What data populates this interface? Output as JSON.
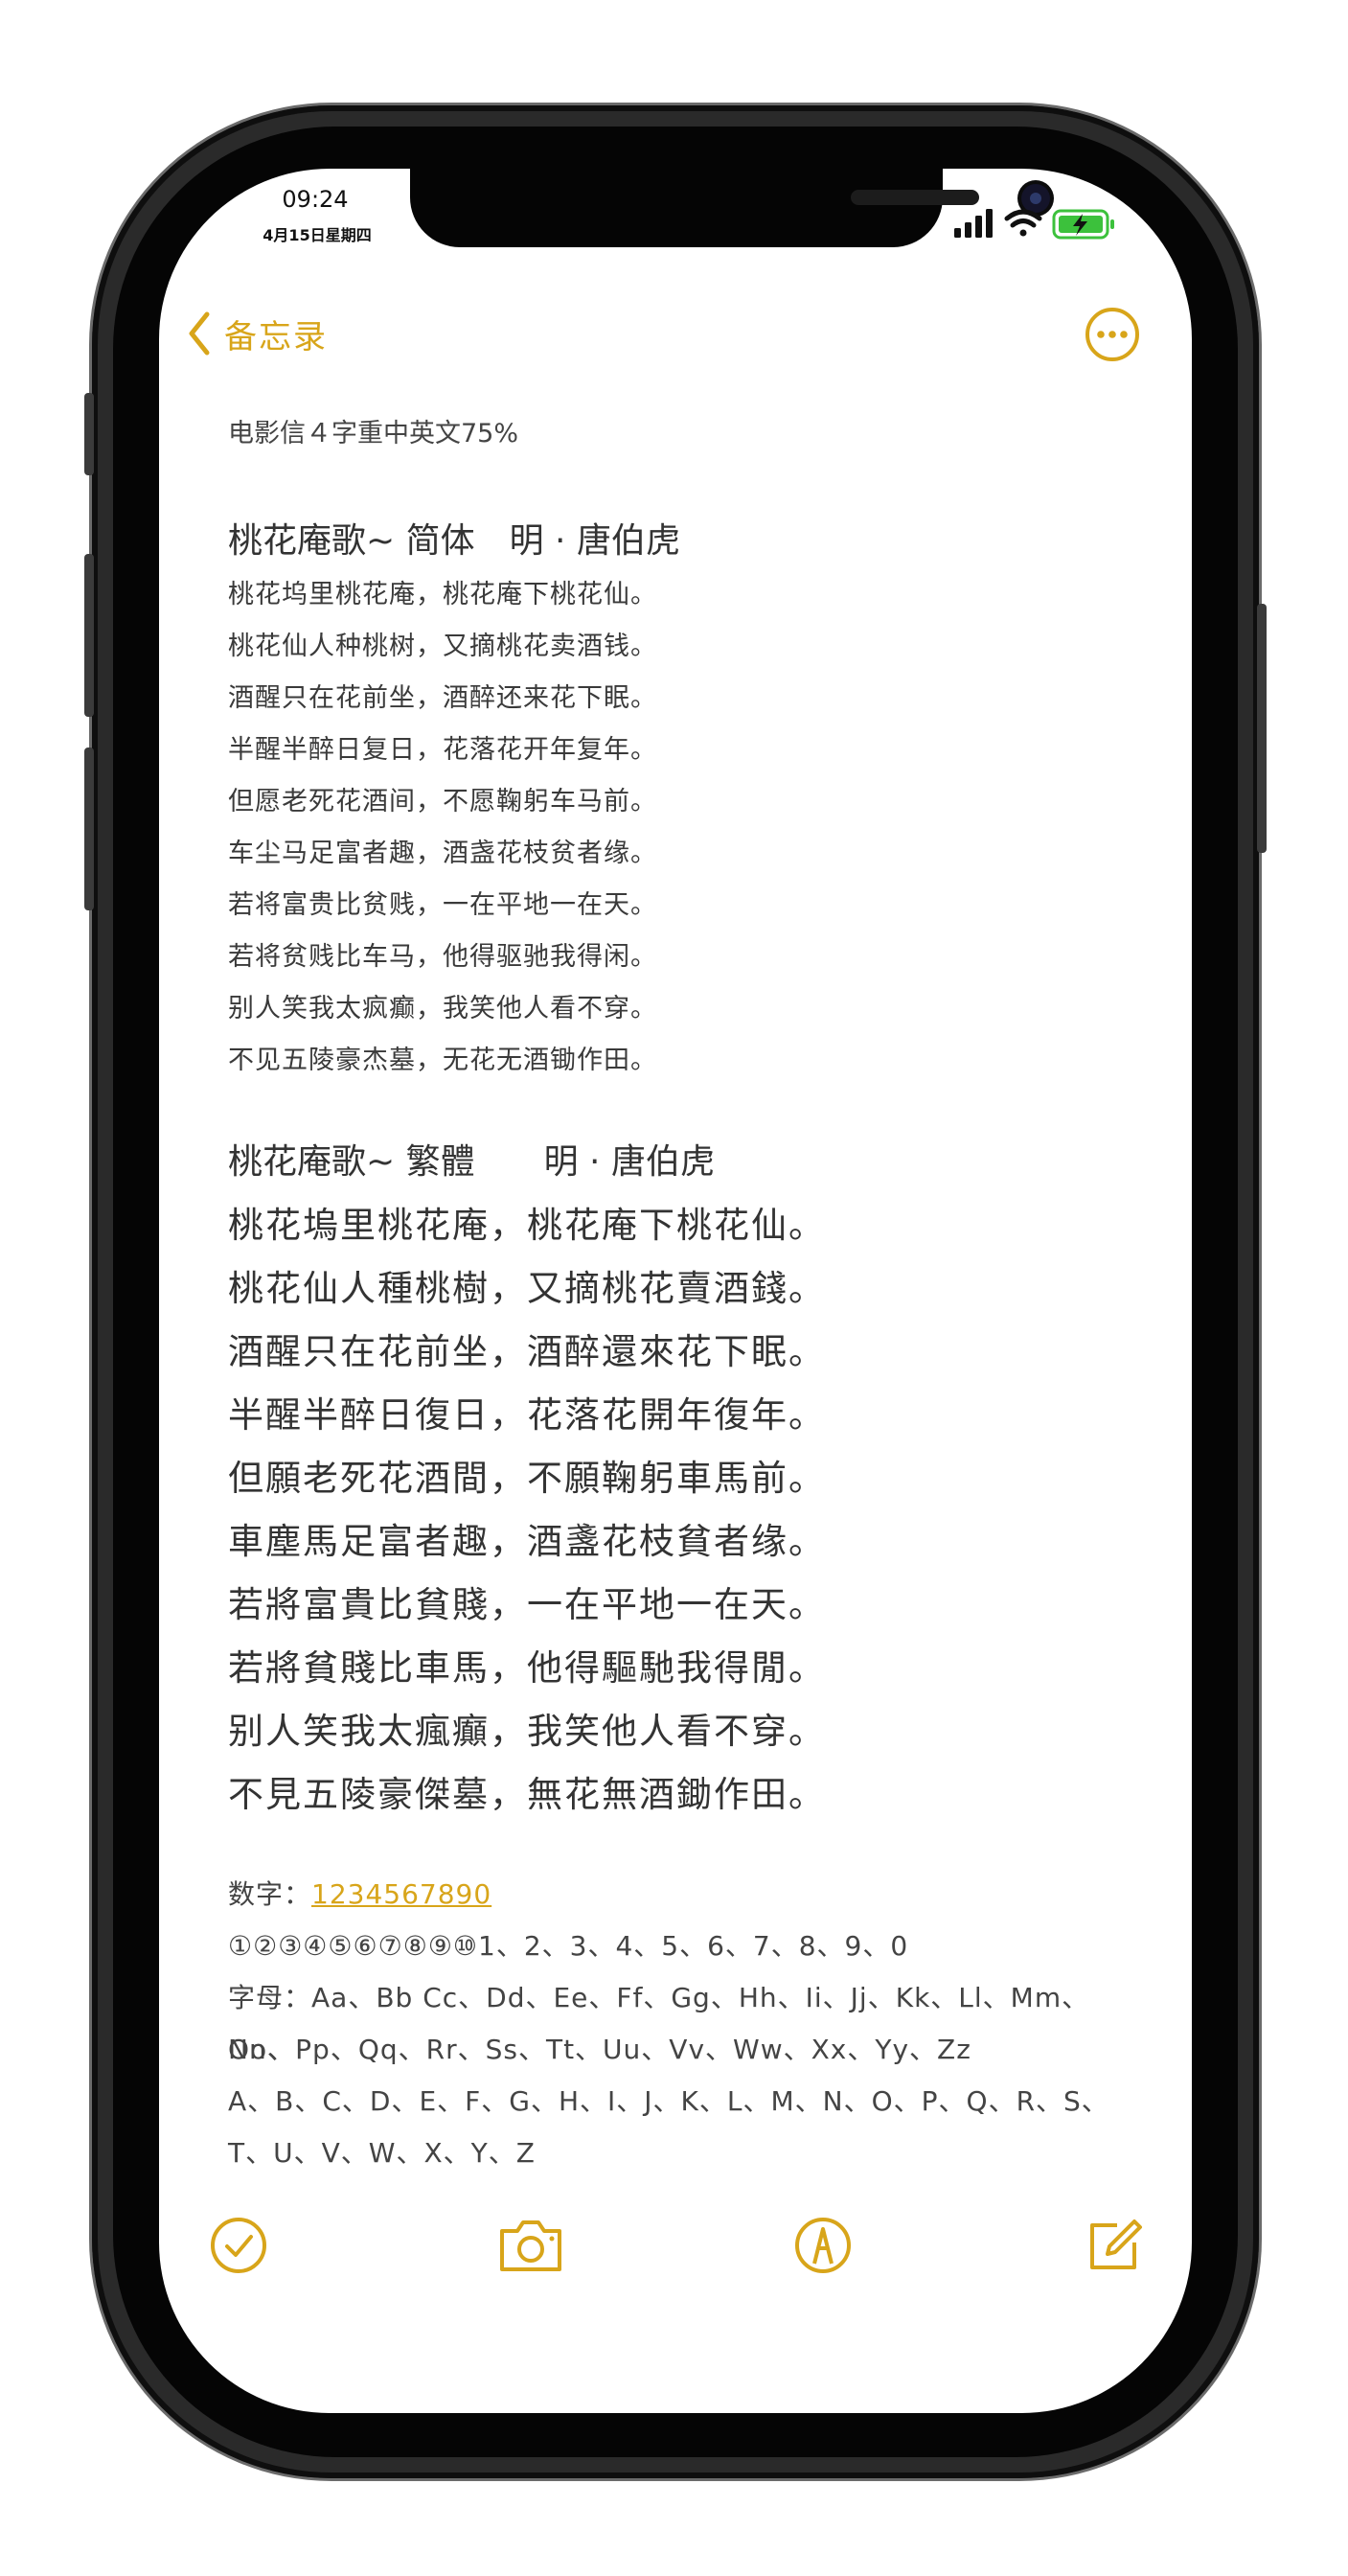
{
  "status": {
    "time": "09:24",
    "date": "4月15日星期四"
  },
  "nav": {
    "back_label": "备忘录"
  },
  "note": {
    "meta": "电影信４字重中英文75%",
    "simplified": {
      "title": "桃花庵歌~ 简体　明 · 唐伯虎",
      "lines": [
        "桃花坞里桃花庵，桃花庵下桃花仙。",
        "桃花仙人种桃树，又摘桃花卖酒钱。",
        "酒醒只在花前坐，酒醉还来花下眠。",
        "半醒半醉日复日，花落花开年复年。",
        "但愿老死花酒间，不愿鞠躬车马前。",
        "车尘马足富者趣，酒盏花枝贫者缘。",
        "若将富贵比贫贱，一在平地一在天。",
        "若将贫贱比车马，他得驱驰我得闲。",
        "别人笑我太疯癫，我笑他人看不穿。",
        "不见五陵豪杰墓，无花无酒锄作田。"
      ]
    },
    "traditional": {
      "title": "桃花庵歌~ 繁體　　明 · 唐伯虎",
      "lines": [
        "桃花塢里桃花庵，桃花庵下桃花仙。",
        "桃花仙人種桃樹，又摘桃花賣酒錢。",
        "酒醒只在花前坐，酒醉還來花下眠。",
        "半醒半醉日復日，花落花開年復年。",
        "但願老死花酒間，不願鞠躬車馬前。",
        "車塵馬足富者趣，酒盞花枝貧者缘。",
        "若將富貴比貧賤，一在平地一在天。",
        "若將貧賤比車馬，他得驅馳我得閒。",
        "别人笑我太瘋癲，我笑他人看不穿。",
        "不見五陵豪傑墓，無花無酒鋤作田。"
      ]
    },
    "digits_label": "数字：",
    "digits_value": "1234567890",
    "circled": "①②③④⑤⑥⑦⑧⑨⑩1、2、3、4、5、6、7、8、9、0",
    "letters_1": "字母：Aa、Bb Cc、Dd、Ee、Ff、Gg、Hh、Ii、Jj、Kk、Ll、Mm、Nn、",
    "letters_2": "Oo、Pp、Qq、Rr、Ss、Tt、Uu、Vv、Ww、Xx、Yy、Zz",
    "upper_1": "A、B、C、D、E、F、G、H、I、J、K、L、M、N、O、P、Q、R、S、",
    "upper_2": "T、U、V、W、X、Y、Z"
  },
  "toolbar": {
    "icons": [
      "checklist-icon",
      "camera-icon",
      "markup-pen-icon",
      "compose-icon"
    ]
  },
  "colors": {
    "accent": "#d8a51a",
    "battery": "#3cc13c",
    "frame": "#2a2a2a"
  }
}
